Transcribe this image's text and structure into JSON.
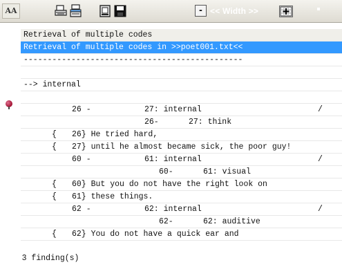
{
  "toolbar": {
    "font_button_label": "AA",
    "minus_label": "-",
    "width_label": "<< Width >>"
  },
  "lines": {
    "header": "Retrieval of multiple codes",
    "selected": "Retrieval of multiple codes in >>poet001.txt<<",
    "separator": "----------------------------------------------",
    "code_marker": "--> internal",
    "r1": {
      "a": "26 -",
      "b": "27: internal",
      "c": "/"
    },
    "r2": {
      "a": "26-",
      "b": "27: think"
    },
    "r3": {
      "br": "{",
      "t": "26} He tried hard,"
    },
    "r4": {
      "br": "{",
      "t": "27} until he almost became sick, the poor guy!"
    },
    "r5": {
      "a": "60 -",
      "b": "61: internal",
      "c": "/"
    },
    "r6": {
      "a": "60-",
      "b": "61: visual"
    },
    "r7": {
      "br": "{",
      "t": "60} But you do not have the right look on"
    },
    "r8": {
      "br": "{",
      "t": "61} these things."
    },
    "r9": {
      "a": "62 -",
      "b": "62: internal",
      "c": "/"
    },
    "r10": {
      "a": "62-",
      "b": "62: auditive"
    },
    "r11": {
      "br": "{",
      "t": "62} You do not have a quick ear and"
    },
    "footer": "3 finding(s)"
  },
  "colors": {
    "selection": "#3399ff",
    "header_bg": "#f0efea",
    "toolbar_bg": "#dedbd2"
  }
}
